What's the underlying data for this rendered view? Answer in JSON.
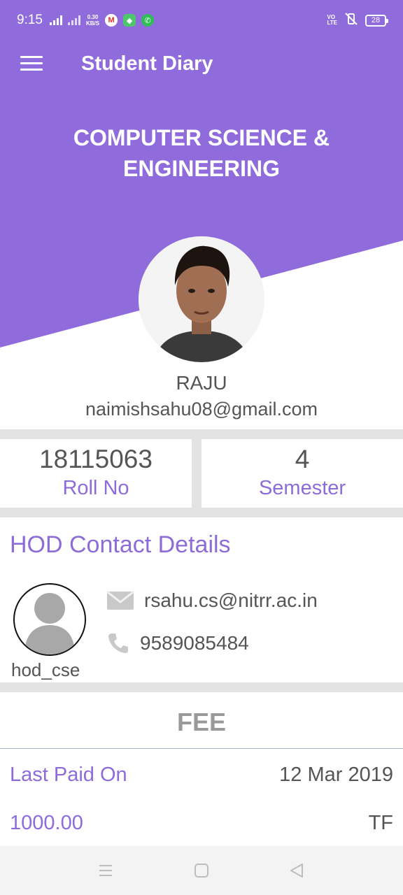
{
  "status_bar": {
    "time": "9:15",
    "net_speed_value": "0.30",
    "net_speed_unit": "KB/S",
    "volte_line1": "VO",
    "volte_line2": "LTE",
    "battery": "28",
    "gmail_icon": "gmail-icon",
    "whatsapp_icon": "whatsapp-icon"
  },
  "app_bar": {
    "title": "Student Diary"
  },
  "header": {
    "department": "COMPUTER SCIENCE & ENGINEERING",
    "accent_color": "#8f6bdb"
  },
  "student": {
    "name": "RAJU",
    "email": "naimishsahu08@gmail.com",
    "roll_no": "18115063",
    "roll_no_label": "Roll No",
    "semester": "4",
    "semester_label": "Semester"
  },
  "hod": {
    "section_title": "HOD Contact Details",
    "username": "hod_cse",
    "email": "rsahu.cs@nitrr.ac.in",
    "phone": "9589085484"
  },
  "fee": {
    "title": "FEE",
    "last_paid_label": "Last Paid On",
    "last_paid_date": "12 Mar 2019",
    "amount": "1000.00",
    "type": "TF"
  }
}
